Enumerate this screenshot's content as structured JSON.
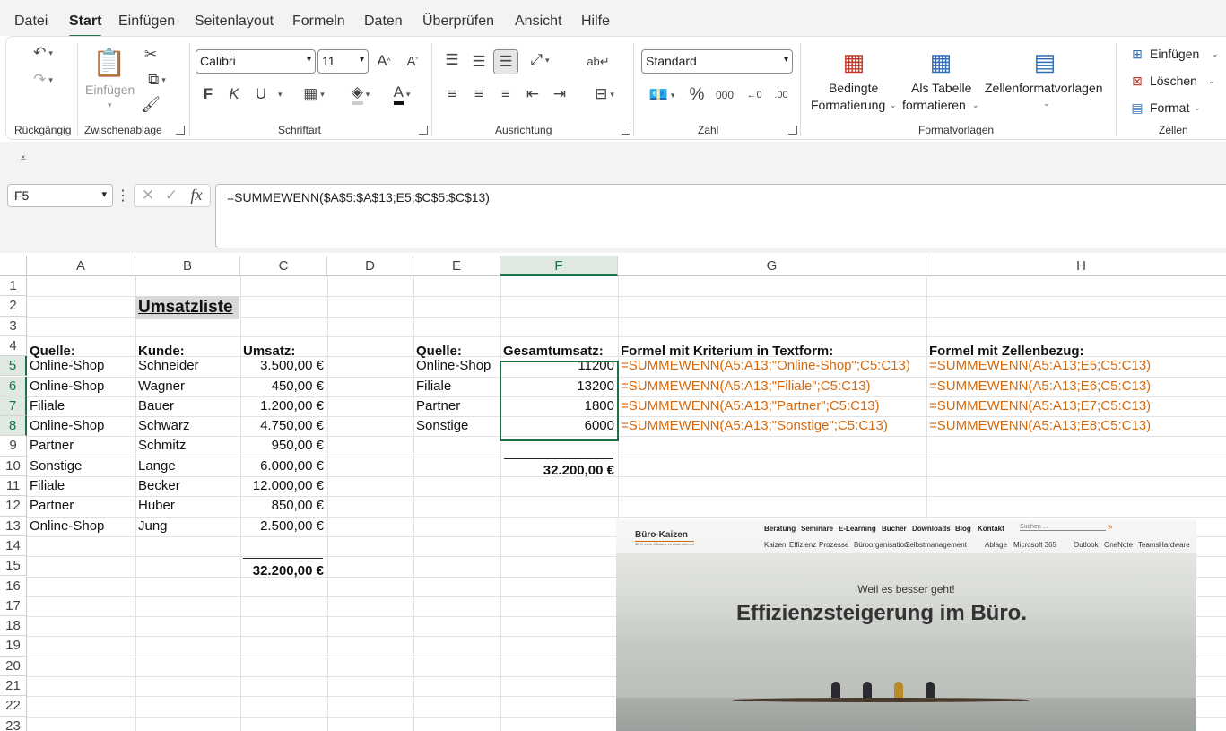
{
  "menu": {
    "tabs": [
      "Datei",
      "Start",
      "Einfügen",
      "Seitenlayout",
      "Formeln",
      "Daten",
      "Überprüfen",
      "Ansicht",
      "Hilfe"
    ]
  },
  "ribbon": {
    "groups": {
      "undo": "Rückgängig",
      "clipboard": "Zwischenablage",
      "font": "Schriftart",
      "alignment": "Ausrichtung",
      "number": "Zahl",
      "styles": "Formatvorlagen",
      "cells": "Zellen"
    },
    "paste_label": "Einfügen",
    "font_name": "Calibri",
    "font_size": "11",
    "number_format": "Standard",
    "cond_format": [
      "Bedingte",
      "Formatierung"
    ],
    "as_table": [
      "Als Tabelle",
      "formatieren"
    ],
    "cell_styles": "Zellenformatvorlagen",
    "cells_insert": "Einfügen",
    "cells_delete": "Löschen",
    "cells_format": "Format",
    "bold": "F",
    "italic": "K",
    "underline": "U",
    "percent": "%",
    "thousands": "000"
  },
  "formula_bar": {
    "name_box": "F5",
    "formula": "=SUMMEWENN($A$5:$A$13;E5;$C$5:$C$13)",
    "fx": "fx"
  },
  "sheet": {
    "columns": [
      "A",
      "B",
      "C",
      "D",
      "E",
      "F",
      "G",
      "H"
    ],
    "selected_column": "F",
    "rows": [
      "1",
      "2",
      "3",
      "4",
      "5",
      "6",
      "7",
      "8",
      "9",
      "10",
      "11",
      "12",
      "13",
      "14",
      "15",
      "16",
      "17",
      "18",
      "19",
      "20",
      "21",
      "22",
      "23"
    ],
    "title": "Umsatzliste",
    "headers": {
      "source": "Quelle:",
      "customer": "Kunde:",
      "revenue": "Umsatz:"
    },
    "data": [
      {
        "source": "Online-Shop",
        "customer": "Schneider",
        "revenue": "3.500,00 €"
      },
      {
        "source": "Online-Shop",
        "customer": "Wagner",
        "revenue": "450,00 €"
      },
      {
        "source": "Filiale",
        "customer": "Bauer",
        "revenue": "1.200,00 €"
      },
      {
        "source": "Online-Shop",
        "customer": "Schwarz",
        "revenue": "4.750,00 €"
      },
      {
        "source": "Partner",
        "customer": "Schmitz",
        "revenue": "950,00 €"
      },
      {
        "source": "Sonstige",
        "customer": "Lange",
        "revenue": "6.000,00 €"
      },
      {
        "source": "Filiale",
        "customer": "Becker",
        "revenue": "12.000,00 €"
      },
      {
        "source": "Partner",
        "customer": "Huber",
        "revenue": "850,00 €"
      },
      {
        "source": "Online-Shop",
        "customer": "Jung",
        "revenue": "2.500,00 €"
      }
    ],
    "total": "32.200,00 €",
    "summary_headers": {
      "source": "Quelle:",
      "total": "Gesamtumsatz:",
      "text_formula": "Formel mit Kriterium in Textform:",
      "ref_formula": "Formel mit Zellenbezug:"
    },
    "summary": [
      {
        "source": "Online-Shop",
        "total": "11200",
        "text_formula": "=SUMMEWENN(A5:A13;\"Online-Shop\";C5:C13)",
        "ref_formula": "=SUMMEWENN(A5:A13;E5;C5:C13)"
      },
      {
        "source": "Filiale",
        "total": "13200",
        "text_formula": "=SUMMEWENN(A5:A13;\"Filiale\";C5:C13)",
        "ref_formula": "=SUMMEWENN(A5:A13;E6;C5:C13)"
      },
      {
        "source": "Partner",
        "total": "1800",
        "text_formula": "=SUMMEWENN(A5:A13;\"Partner\";C5:C13)",
        "ref_formula": "=SUMMEWENN(A5:A13;E7;C5:C13)"
      },
      {
        "source": "Sonstige",
        "total": "6000",
        "text_formula": "=SUMMEWENN(A5:A13;\"Sonstige\";C5:C13)",
        "ref_formula": "=SUMMEWENN(A5:A13;E8;C5:C13)"
      }
    ],
    "summary_total": "32.200,00 €"
  },
  "ad": {
    "logo": "Büro-Kaizen",
    "logo_tag": "30 % mehr Effizienz im Unternehmen",
    "nav": [
      "Beratung",
      "Seminare",
      "E-Learning",
      "Bücher",
      "Downloads",
      "Blog",
      "Kontakt"
    ],
    "search_placeholder": "Suchen ...",
    "subnav": [
      "Kaizen",
      "Effizienz",
      "Prozesse",
      "Büroorganisation",
      "Selbstmanagement",
      "Ablage",
      "Microsoft 365",
      "Outlook",
      "OneNote",
      "Teams",
      "Hardware"
    ],
    "tagline": "Weil es besser geht!",
    "headline": "Effizienzsteigerung im Büro."
  },
  "colors": {
    "accent": "#1e7145",
    "formula_text": "#d46a10"
  }
}
